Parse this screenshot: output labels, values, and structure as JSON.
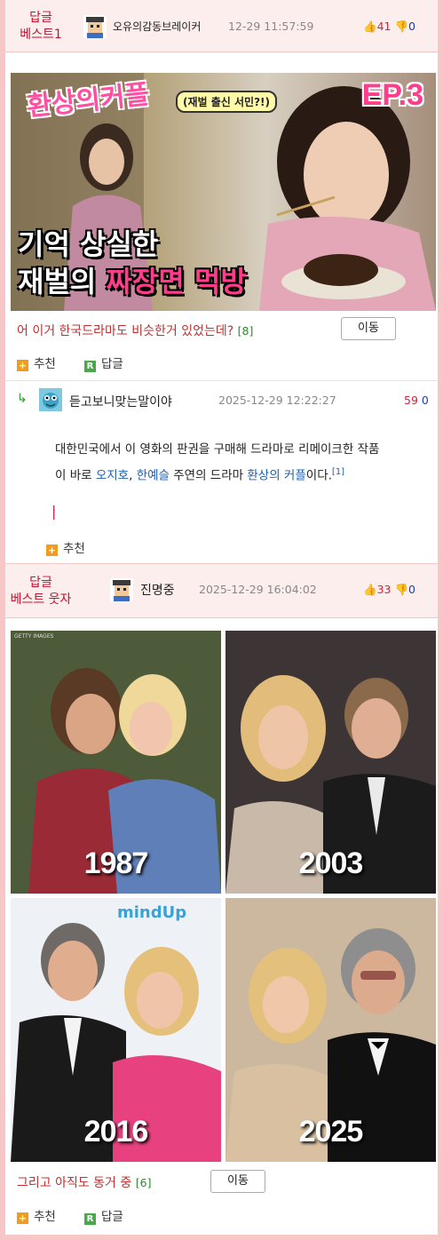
{
  "post1": {
    "tag_line1": "답글",
    "tag_line2": "베스트1",
    "nickname": "오유의감동브레이커",
    "date": "12-29 11:57:59",
    "upvotes": "41",
    "downvotes": "0",
    "image": {
      "title_left": "환상의커플",
      "subtitle": "(재벌 출신 서민?!)",
      "episode": "EP.3",
      "line1": "기억 상실한",
      "line2_a": "재벌의 ",
      "line2_b": "짜장면 먹방"
    },
    "caption": "어 이거 한국드라마도 비슷한거 있었는데?",
    "comment_count": "[8]",
    "move_label": "이동",
    "recommend_label": "추천",
    "reply_label": "답글"
  },
  "reply1": {
    "nickname": "듣고보니맞는말이야",
    "date": "2025-12-29 12:22:27",
    "upvotes": "59",
    "downvotes": "0",
    "text_1": "대한민국에서 이 영화의 판권을 구매해 드라마로 리메이크한 작품",
    "text_2": "이 바로 ",
    "link1": "오지호",
    "text_3": ", ",
    "link2": "한예슬",
    "text_4": " 주연의 드라마 ",
    "link3": "환상의 커플",
    "text_5": "이다.",
    "footnote": "[1]",
    "cursor": "|",
    "recommend_label": "추천"
  },
  "post2": {
    "tag_line1": "답글",
    "tag_line2": "베스트 웃자",
    "nickname": "진명중",
    "date": "2025-12-29 16:04:02",
    "upvotes": "33",
    "downvotes": "0",
    "photos": [
      {
        "year": "1987",
        "watermark": "GETTY IMAGES"
      },
      {
        "year": "2003"
      },
      {
        "year": "2016",
        "banner": "mindUp"
      },
      {
        "year": "2025"
      }
    ],
    "caption": "그리고 아직도 동거 중",
    "comment_count": "[6]",
    "move_label": "이동",
    "recommend_label": "추천",
    "reply_label": "답글"
  },
  "colors": {
    "frame": "#f7c6c6",
    "header_bg": "#fdeeee",
    "tag_red": "#c8102e",
    "link_blue": "#1a5fb4",
    "count_green": "#2a8a2a"
  }
}
